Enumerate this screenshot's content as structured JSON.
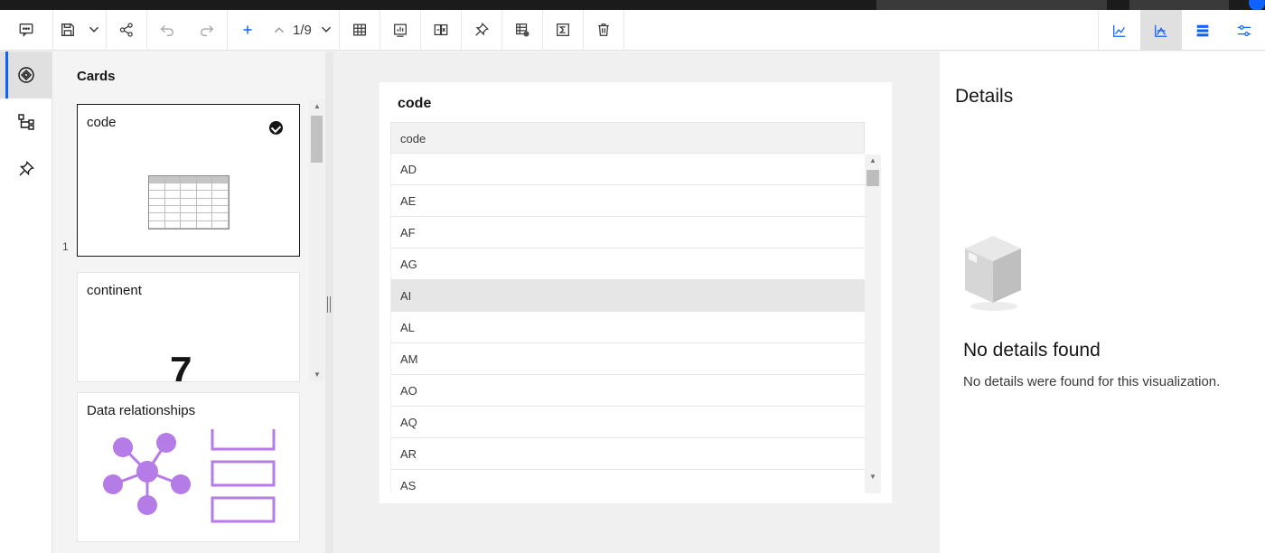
{
  "toolbar": {
    "page_counter": "1/9",
    "icons": [
      "comment-icon",
      "save-icon",
      "chevron-down-icon",
      "share-icon",
      "undo-icon",
      "redo-icon",
      "add-icon",
      "chevron-up-icon",
      "chevron-down-icon",
      "table-icon",
      "insert-chart-icon",
      "insert-visualization-icon",
      "pin-icon",
      "table-settings-icon",
      "summarize-icon",
      "delete-icon"
    ],
    "right_icons": [
      "line-chart-icon",
      "chart-type-icon",
      "fields-icon",
      "properties-icon"
    ]
  },
  "rail": {
    "items": [
      {
        "name": "visualizations-icon",
        "active": true
      },
      {
        "name": "data-tree-icon",
        "active": false
      },
      {
        "name": "pin-icon",
        "active": false
      }
    ]
  },
  "cards": {
    "title": "Cards",
    "items": [
      {
        "label": "code",
        "number": "1",
        "selected": true
      },
      {
        "label": "continent",
        "digit": "7"
      },
      {
        "label": "Data relationships"
      }
    ]
  },
  "visualization": {
    "title": "code",
    "column_header": "code",
    "rows": [
      "AD",
      "AE",
      "AF",
      "AG",
      "AI",
      "AL",
      "AM",
      "AO",
      "AQ",
      "AR",
      "AS"
    ],
    "highlighted_row": "AI"
  },
  "details": {
    "title": "Details",
    "empty_title": "No details found",
    "empty_desc": "No details were found for this visualization."
  },
  "colors": {
    "accent": "#0f62fe",
    "relationship_purple": "#b57be6"
  }
}
